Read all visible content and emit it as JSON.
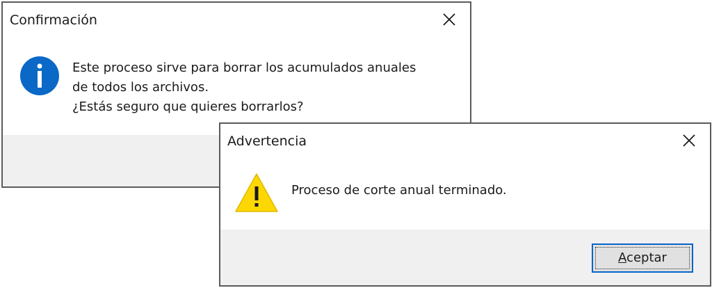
{
  "confirm_dialog": {
    "title": "Confirmación",
    "icon": "info-icon",
    "message_lines": [
      "Este proceso sirve para borrar los acumulados anuales",
      "de todos los archivos.",
      "¿Estás seguro que quieres borrarlos?"
    ]
  },
  "warning_dialog": {
    "title": "Advertencia",
    "icon": "warning-icon",
    "message": "Proceso de corte anual terminado.",
    "accept_button": {
      "mnemonic": "A",
      "rest": "ceptar"
    }
  },
  "colors": {
    "info_blue": "#0a68c6",
    "warning_yellow": "#fcd703",
    "accent_border": "#0a64c8"
  }
}
